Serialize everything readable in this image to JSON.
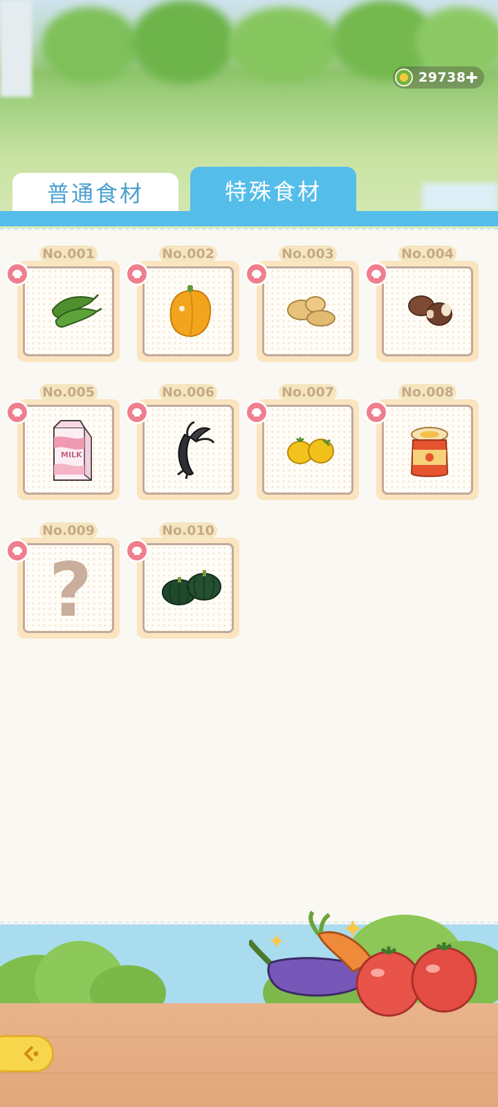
{
  "currency": {
    "value": "29738",
    "icon": "coin-icon",
    "add_icon": "plus-icon"
  },
  "tabs": [
    {
      "label": "普通食材",
      "active": false
    },
    {
      "label": "特殊食材",
      "active": true
    }
  ],
  "items": [
    {
      "number": "No.001",
      "icon": "green-pepper-icon",
      "unlocked": true
    },
    {
      "number": "No.002",
      "icon": "yellow-bell-pepper-icon",
      "unlocked": true
    },
    {
      "number": "No.003",
      "icon": "potato-icon",
      "unlocked": true
    },
    {
      "number": "No.004",
      "icon": "mushroom-icon",
      "unlocked": true
    },
    {
      "number": "No.005",
      "icon": "milk-carton-icon",
      "unlocked": true,
      "text": "MILK"
    },
    {
      "number": "No.006",
      "icon": "black-shrimp-icon",
      "unlocked": true
    },
    {
      "number": "No.007",
      "icon": "yellow-tomato-icon",
      "unlocked": true
    },
    {
      "number": "No.008",
      "icon": "jam-jar-icon",
      "unlocked": true
    },
    {
      "number": "No.009",
      "icon": "question-mark-icon",
      "unlocked": false,
      "text": "?"
    },
    {
      "number": "No.010",
      "icon": "pumpkin-icon",
      "unlocked": true
    }
  ],
  "colors": {
    "tab_active": "#55bde9",
    "tab_inactive_text": "#4ba0cf",
    "badge": "#ef7e8e",
    "frame": "#fae5c0",
    "back_button": "#f8d64c"
  },
  "back_button": {
    "icon": "back-arrow-icon"
  }
}
